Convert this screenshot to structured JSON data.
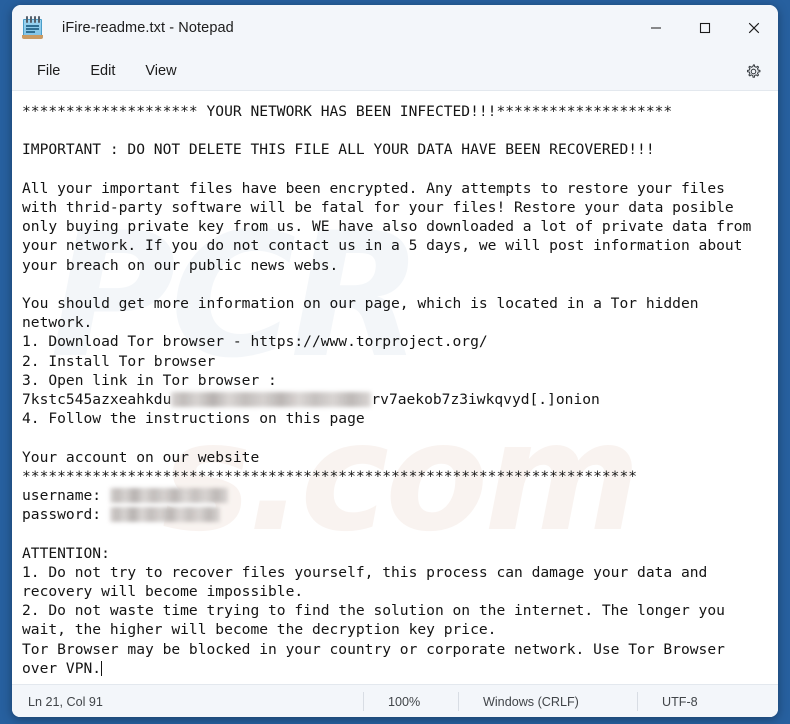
{
  "window": {
    "title": "iFire-readme.txt - Notepad",
    "app_icon": "notepad-icon",
    "controls": {
      "minimize": "minimize-icon",
      "maximize": "maximize-icon",
      "close": "close-icon"
    }
  },
  "menubar": {
    "items": [
      {
        "label": "File"
      },
      {
        "label": "Edit"
      },
      {
        "label": "View"
      }
    ],
    "settings_icon": "gear-icon"
  },
  "editor": {
    "watermark_big": "PCR",
    "watermark_dot": "s.com",
    "lines": [
      "******************** YOUR NETWORK HAS BEEN INFECTED!!!********************",
      "",
      "IMPORTANT : DO NOT DELETE THIS FILE ALL YOUR DATA HAVE BEEN RECOVERED!!!",
      "",
      "All your important files have been encrypted. Any attempts to restore your files with thrid-party software will be fatal for your files! Restore your data posible only buying private key from us. WE have also downloaded a lot of private data from your network. If you do not contact us in a 5 days, we will post information about your breach on our public news webs.",
      "",
      "You should get more information on our page, which is located in a Tor hidden network.",
      "1. Download Tor browser - https://www.torproject.org/",
      "2. Install Tor browser",
      "3. Open link in Tor browser :",
      "4. Follow the instructions on this page",
      "",
      "Your account on our website",
      "**********************************************************************",
      "",
      "ATTENTION:",
      "1. Do not try to recover files yourself, this process can damage your data and recovery will become impossible.",
      "2. Do not waste time trying to find the solution on the internet. The longer you wait, the higher will become the decryption key price.",
      "Tor Browser may be blocked in your country or corporate network. Use Tor Browser over VPN."
    ],
    "onion_prefix": "7kstc545azxeahkdu",
    "onion_suffix": "rv7aekob7z3iwkqvyd[.]onion",
    "username_label": "username: ",
    "password_label": "password: ",
    "username_value": "",
    "password_value": ""
  },
  "statusbar": {
    "position": "Ln 21, Col 91",
    "zoom": "100%",
    "line_ending": "Windows (CRLF)",
    "encoding": "UTF-8"
  },
  "colors": {
    "window_border": "#27609f",
    "chrome": "#f3f6fa",
    "editor_bg": "#ffffff",
    "text": "#141414",
    "status_text": "#414549"
  }
}
